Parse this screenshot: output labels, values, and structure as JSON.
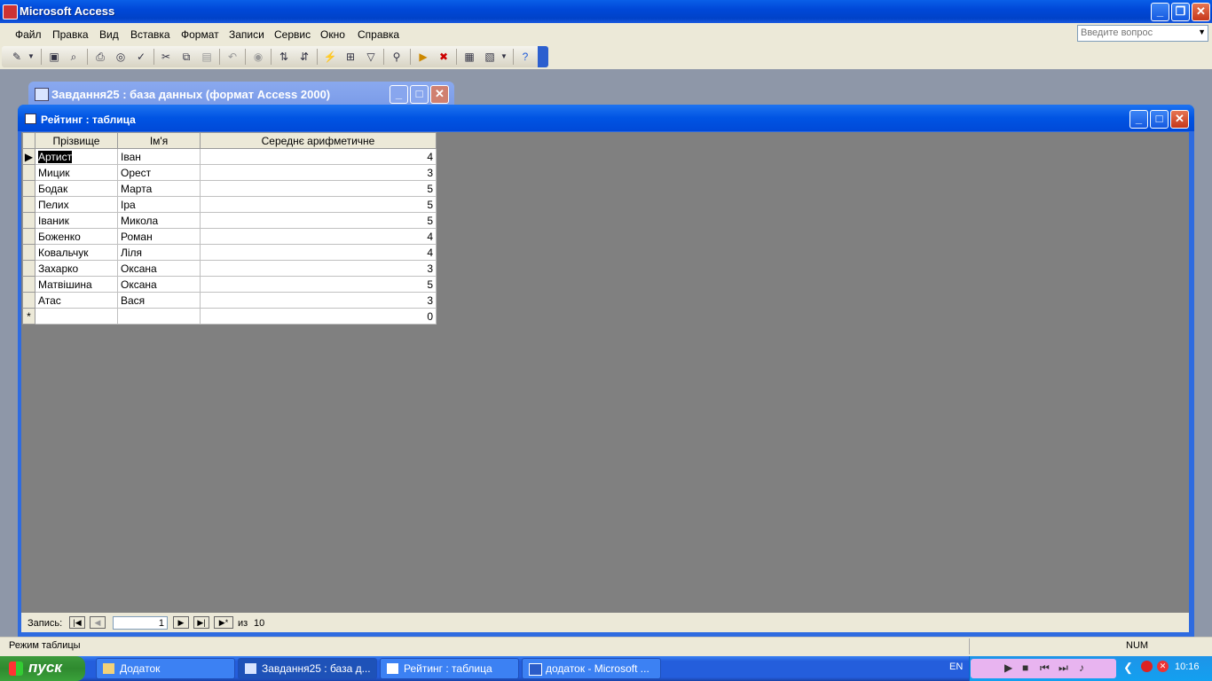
{
  "app": {
    "title": "Microsoft Access"
  },
  "menu": {
    "items": [
      "Файл",
      "Правка",
      "Вид",
      "Вставка",
      "Формат",
      "Записи",
      "Сервис",
      "Окно",
      "Справка"
    ],
    "help_placeholder": "Введите вопрос"
  },
  "db_window": {
    "title": "Завдання25 : база данных (формат Access 2000)"
  },
  "table_window": {
    "title": "Рейтинг : таблица"
  },
  "datasheet": {
    "columns": [
      "Прізвище",
      "Ім'я",
      "Середнє арифметичне"
    ],
    "rows": [
      [
        "Артист",
        "Іван",
        "4"
      ],
      [
        "Мицик",
        "Орест",
        "3"
      ],
      [
        "Бодак",
        "Марта",
        "5"
      ],
      [
        "Пелих",
        "Іра",
        "5"
      ],
      [
        "Іваник",
        "Микола",
        "5"
      ],
      [
        "Боженко",
        "Роман",
        "4"
      ],
      [
        "Ковальчук",
        "Ліля",
        "4"
      ],
      [
        "Захарко",
        "Оксана",
        "3"
      ],
      [
        "Матвішина",
        "Оксана",
        "5"
      ],
      [
        "Атас",
        "Вася",
        "3"
      ]
    ],
    "new_row_value": "0"
  },
  "navigation": {
    "label": "Запись:",
    "current": "1",
    "of_label": "из",
    "total": "10"
  },
  "status": {
    "mode": "Режим таблицы",
    "num": "NUM"
  },
  "taskbar": {
    "start": "пуск",
    "tasks": [
      "Додаток",
      "Завдання25 : база д...",
      "Рейтинг : таблица",
      "додаток - Microsoft ..."
    ],
    "lang": "EN",
    "clock": "10:16"
  }
}
